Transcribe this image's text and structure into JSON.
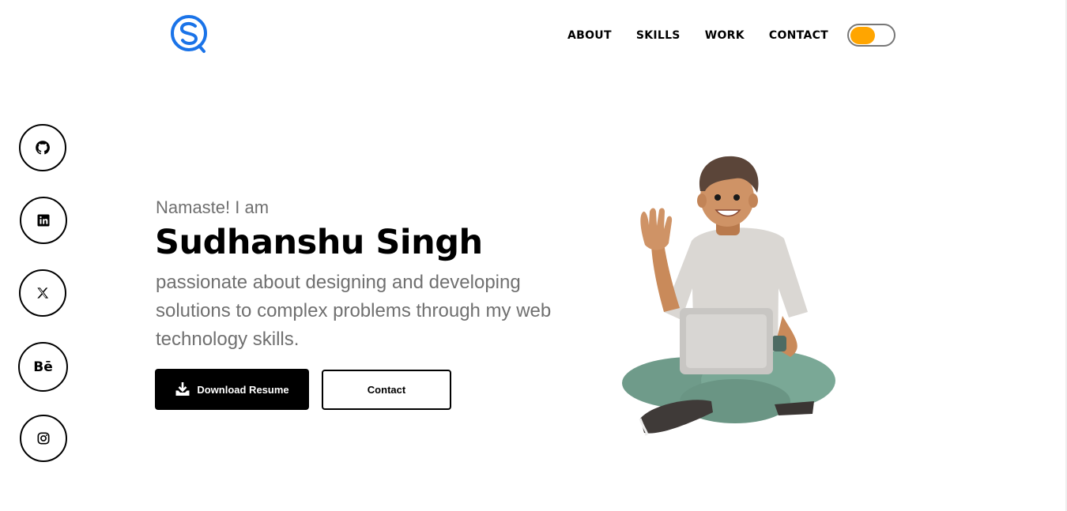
{
  "brand": {
    "logo_icon": "s-logo-icon",
    "accent": "#1a73e8"
  },
  "nav": {
    "items": [
      {
        "label": "ABOUT"
      },
      {
        "label": "SKILLS"
      },
      {
        "label": "WORK"
      },
      {
        "label": "CONTACT"
      }
    ],
    "theme_toggle": {
      "icon": "theme-toggle",
      "knob_color": "#ffa500"
    }
  },
  "social": [
    {
      "icon": "github-icon"
    },
    {
      "icon": "linkedin-icon"
    },
    {
      "icon": "x-twitter-icon"
    },
    {
      "icon": "behance-icon",
      "text": "Bē"
    },
    {
      "icon": "instagram-icon"
    }
  ],
  "hero": {
    "greeting": "Namaste! I am",
    "name": "Sudhanshu Singh",
    "tagline": "passionate about designing and developing solutions to complex problems through my web technology skills.",
    "buttons": {
      "download_label": "Download Resume",
      "contact_label": "Contact"
    },
    "illustration_icon": "waving-person-with-laptop-illustration"
  }
}
